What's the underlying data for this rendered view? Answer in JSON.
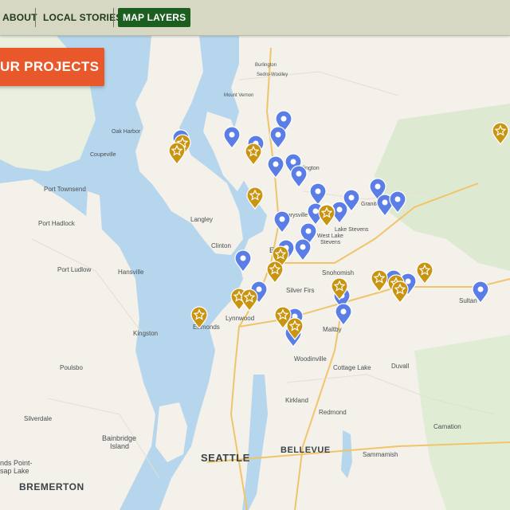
{
  "nav": {
    "about": "ABOUT",
    "local_stories": "LOCAL STORIES",
    "map_layers": "MAP LAYERS"
  },
  "cta": {
    "label": "UR PROJECTS"
  },
  "colors": {
    "nav_bg": "#d6d8c4",
    "active_tab": "#1b5e1f",
    "cta": "#e8582a",
    "water": "#b6d6ed",
    "land": "#f3f1ea",
    "blue_pin": "#5b7ee6",
    "gold_pin": "#c9940f"
  },
  "map": {
    "labels": {
      "oak_harbor": "Oak Harbor",
      "coupeville": "Coupeville",
      "port_townsend": "Port Townsend",
      "port_hadlock": "Port Hadlock",
      "port_ludlow": "Port Ludlow",
      "hansville": "Hansville",
      "kingston": "Kingston",
      "poulsbo": "Poulsbo",
      "silverdale": "Silverdale",
      "bainbridge_island_1": "Bainbridge",
      "bainbridge_island_2": "Island",
      "bremerton": "BREMERTON",
      "ends_point": "nds Point-",
      "sap_lake": "sap Lake",
      "langley": "Langley",
      "clinton": "Clinton",
      "edmonds": "Edmonds",
      "lynnwood": "Lynnwood",
      "silver_firs": "Silver Firs",
      "snohomish": "Snohomish",
      "lake_stevens": "Lake Stevens",
      "west_lake_stevens_1": "West Lake",
      "west_lake_stevens_2": "Stevens",
      "marysville": "Marysville",
      "everett": "Ev",
      "arlington": "Arlington",
      "granite": "Granite",
      "maltby": "Maltby",
      "woodinville": "Woodinville",
      "cottage_lake": "Cottage Lake",
      "duvall": "Duvall",
      "kirkland": "Kirkland",
      "redmond": "Redmond",
      "seattle": "SEATTLE",
      "bellevue": "BELLEVUE",
      "sammamish": "Sammamish",
      "carnation": "Carnation",
      "sultan": "Sultan",
      "mount_vernon": "Mount Vernon",
      "burlington": "Burlington",
      "sedro_woolley": "Sedro-Woolley"
    },
    "markers": {
      "blue_count": 29,
      "gold_count": 24
    }
  }
}
